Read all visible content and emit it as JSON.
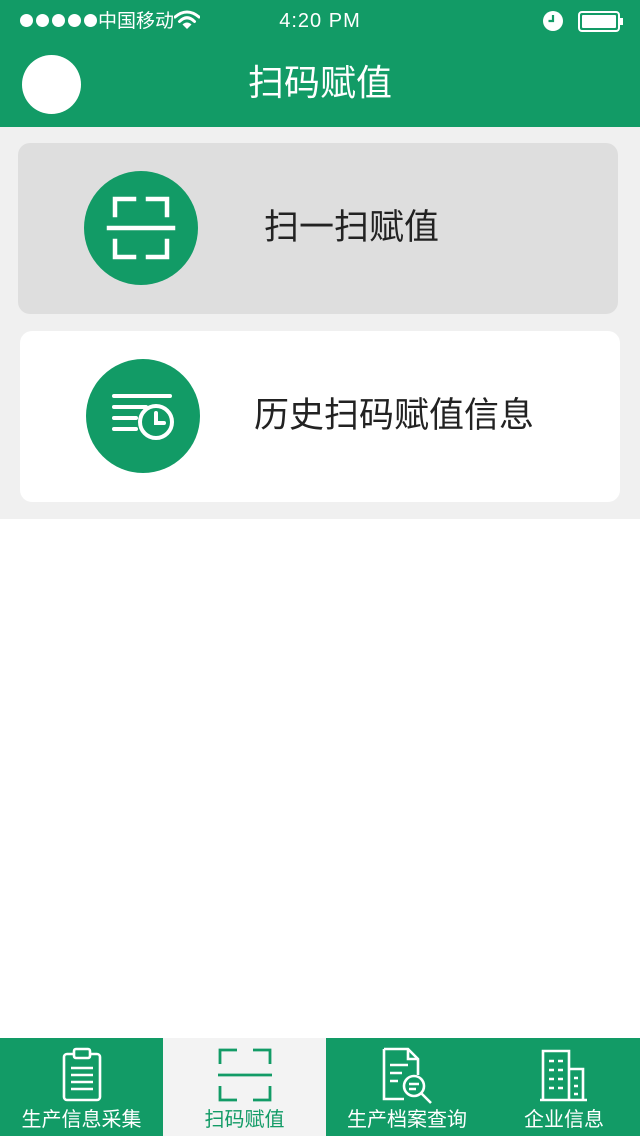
{
  "status_bar": {
    "carrier": "中国移动",
    "time": "4:20 PM"
  },
  "nav": {
    "title": "扫码赋值"
  },
  "cards": [
    {
      "label": "扫一扫赋值",
      "icon": "scan-icon"
    },
    {
      "label": "历史扫码赋值信息",
      "icon": "history-list-clock-icon"
    }
  ],
  "tabs": [
    {
      "label": "生产信息采集",
      "icon": "clipboard-icon",
      "active": false
    },
    {
      "label": "扫码赋值",
      "icon": "scan-icon",
      "active": true
    },
    {
      "label": "生产档案查询",
      "icon": "document-search-icon",
      "active": false
    },
    {
      "label": "企业信息",
      "icon": "building-icon",
      "active": false
    }
  ],
  "colors": {
    "brand": "#129b66",
    "content_bg": "#f0f0f0",
    "card_pressed": "#dedede",
    "tab_active_bg": "#f3f3f3"
  }
}
